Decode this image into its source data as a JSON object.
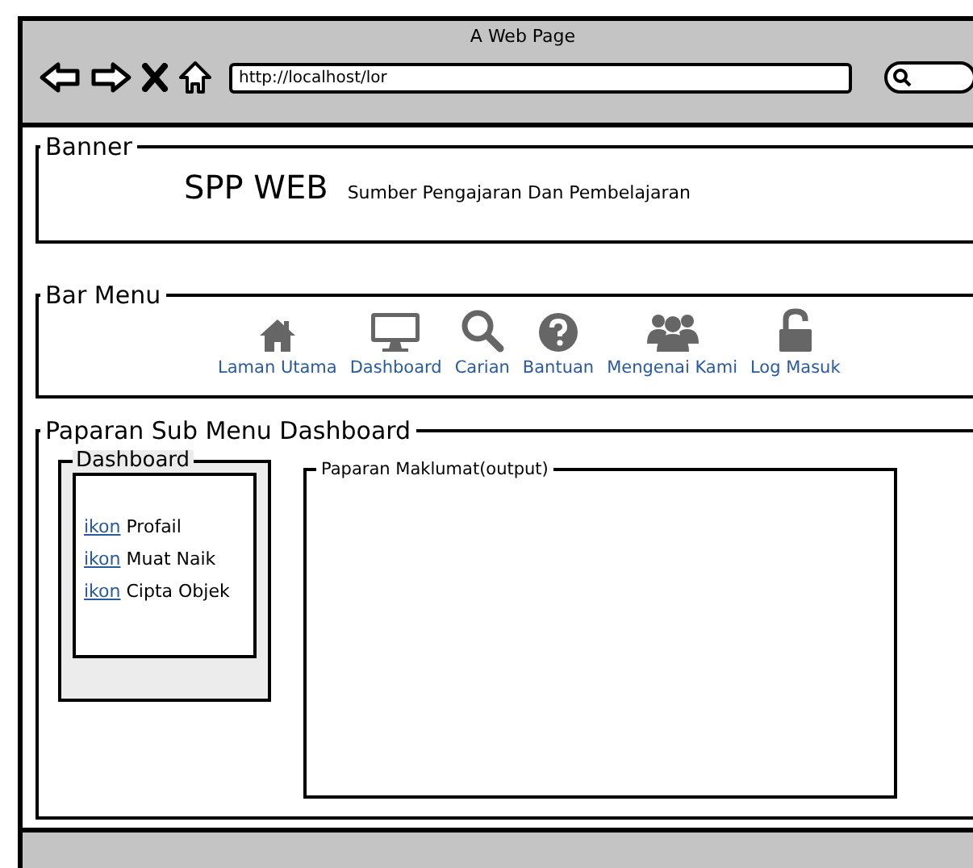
{
  "window": {
    "title": "A Web Page",
    "url": "http://localhost/lor"
  },
  "banner": {
    "legend": "Banner",
    "title": "SPP WEB",
    "subtitle": "Sumber Pengajaran Dan Pembelajaran"
  },
  "bar_menu": {
    "legend": "Bar Menu",
    "items": [
      {
        "label": "Laman Utama"
      },
      {
        "label": "Dashboard"
      },
      {
        "label": "Carian"
      },
      {
        "label": "Bantuan"
      },
      {
        "label": "Mengenai Kami"
      },
      {
        "label": "Log Masuk"
      }
    ]
  },
  "sub_menu": {
    "legend": "Paparan Sub Menu Dashboard",
    "dashboard": {
      "legend": "Dashboard",
      "items": [
        {
          "link": "ikon",
          "label": "Profail"
        },
        {
          "link": "ikon",
          "label": "Muat Naik"
        },
        {
          "link": "ikon",
          "label": "Cipta Objek"
        }
      ]
    },
    "output": {
      "legend": "Paparan Maklumat(output)"
    }
  }
}
